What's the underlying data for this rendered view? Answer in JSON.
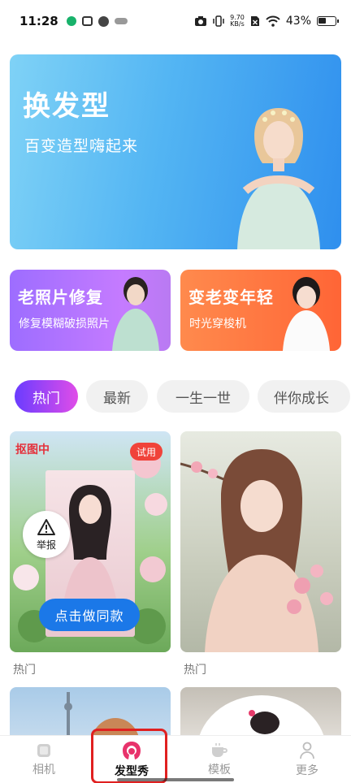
{
  "status_bar": {
    "time": "11:28",
    "net_speed_value": "9.70",
    "net_speed_unit": "KB/s",
    "battery": "43%"
  },
  "hero": {
    "title": "换发型",
    "subtitle": "百变造型嗨起来"
  },
  "features": [
    {
      "title": "老照片修复",
      "subtitle": "修复模糊破损照片"
    },
    {
      "title": "变老变年轻",
      "subtitle": "时光穿梭机"
    }
  ],
  "categories": {
    "items": [
      "热门",
      "最新",
      "一生一世",
      "伴你成长"
    ],
    "active": "热门"
  },
  "templates": [
    {
      "status": "抠图中",
      "badge": "试用",
      "report_label": "举报",
      "action_label": "点击做同款",
      "caption": "热门"
    },
    {
      "caption": "热门"
    }
  ],
  "bottom_nav": {
    "items": [
      "相机",
      "发型秀",
      "模板",
      "更多"
    ],
    "active": "发型秀"
  },
  "colors": {
    "hero_blue": "#2f8fee",
    "restore_purple": "#b97af2",
    "age_orange": "#ff6536",
    "accent_blue": "#1b78e8",
    "badge_red": "#f0433a",
    "chip_gradient_start": "#6a3cff",
    "chip_gradient_end": "#e04de8",
    "nav_active_pink": "#e8336b"
  }
}
